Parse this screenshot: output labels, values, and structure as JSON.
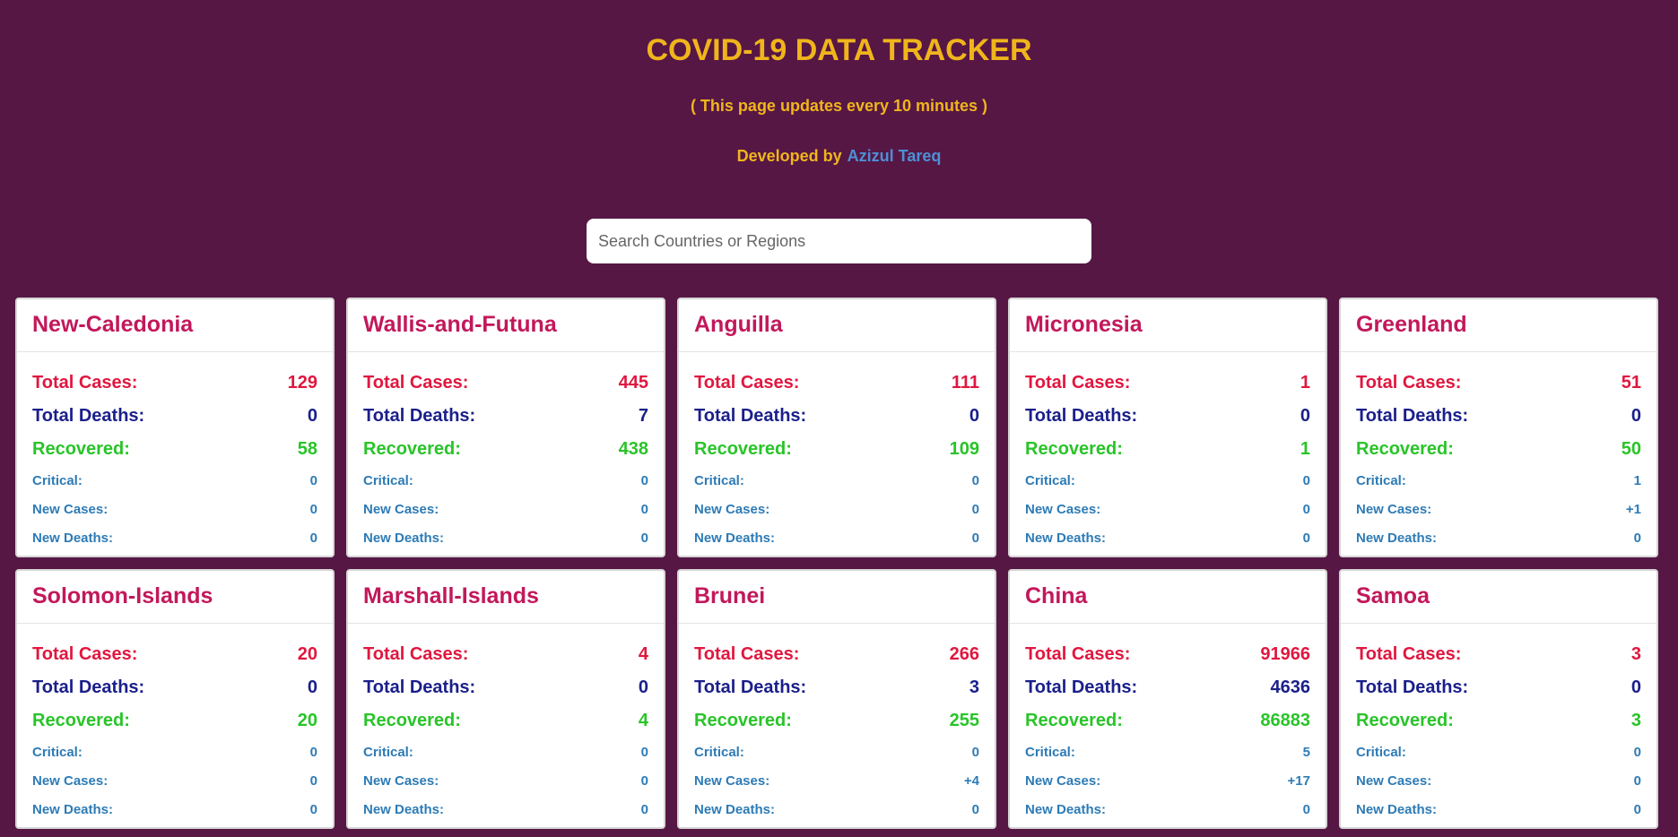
{
  "header": {
    "title": "COVID-19 DATA TRACKER",
    "subtitle": "( This page updates every 10 minutes )",
    "developed_by": "Developed by",
    "author": "Azizul Tareq"
  },
  "search": {
    "placeholder": "Search Countries or Regions",
    "value": ""
  },
  "labels": {
    "total_cases": "Total Cases:",
    "total_deaths": "Total Deaths:",
    "recovered": "Recovered:",
    "critical": "Critical:",
    "new_cases": "New Cases:",
    "new_deaths": "New Deaths:"
  },
  "colors": {
    "background": "#561745",
    "title": "#f0b51b",
    "link": "#4c90d6",
    "country": "#c2185b",
    "total_cases": "#e0173f",
    "total_deaths": "#1a1f8a",
    "recovered": "#29c429",
    "minor_stats": "#2d7bb6"
  },
  "countries": [
    {
      "name": "New-Caledonia",
      "total_cases": "129",
      "total_deaths": "0",
      "recovered": "58",
      "critical": "0",
      "new_cases": "0",
      "new_deaths": "0"
    },
    {
      "name": "Wallis-and-Futuna",
      "total_cases": "445",
      "total_deaths": "7",
      "recovered": "438",
      "critical": "0",
      "new_cases": "0",
      "new_deaths": "0"
    },
    {
      "name": "Anguilla",
      "total_cases": "111",
      "total_deaths": "0",
      "recovered": "109",
      "critical": "0",
      "new_cases": "0",
      "new_deaths": "0"
    },
    {
      "name": "Micronesia",
      "total_cases": "1",
      "total_deaths": "0",
      "recovered": "1",
      "critical": "0",
      "new_cases": "0",
      "new_deaths": "0"
    },
    {
      "name": "Greenland",
      "total_cases": "51",
      "total_deaths": "0",
      "recovered": "50",
      "critical": "1",
      "new_cases": "+1",
      "new_deaths": "0"
    },
    {
      "name": "Solomon-Islands",
      "total_cases": "20",
      "total_deaths": "0",
      "recovered": "20",
      "critical": "0",
      "new_cases": "0",
      "new_deaths": "0"
    },
    {
      "name": "Marshall-Islands",
      "total_cases": "4",
      "total_deaths": "0",
      "recovered": "4",
      "critical": "0",
      "new_cases": "0",
      "new_deaths": "0"
    },
    {
      "name": "Brunei",
      "total_cases": "266",
      "total_deaths": "3",
      "recovered": "255",
      "critical": "0",
      "new_cases": "+4",
      "new_deaths": "0"
    },
    {
      "name": "China",
      "total_cases": "91966",
      "total_deaths": "4636",
      "recovered": "86883",
      "critical": "5",
      "new_cases": "+17",
      "new_deaths": "0"
    },
    {
      "name": "Samoa",
      "total_cases": "3",
      "total_deaths": "0",
      "recovered": "3",
      "critical": "0",
      "new_cases": "0",
      "new_deaths": "0"
    }
  ]
}
